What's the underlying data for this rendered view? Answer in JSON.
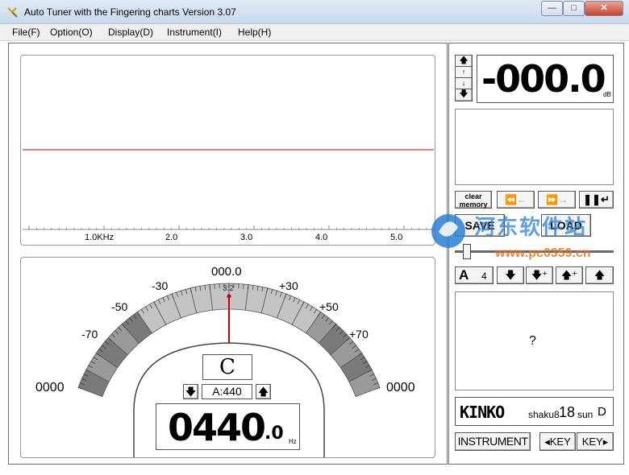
{
  "window": {
    "title": "Auto Tuner with the Fingering charts  Version 3.07",
    "min": "—",
    "max": "□",
    "close": "✕"
  },
  "menu": [
    "File(F)",
    "Option(O)",
    "Display(D)",
    "Instrument(I)",
    "Help(H)"
  ],
  "spectrum": {
    "ticks": [
      "1.0KHz",
      "2.0",
      "3.0",
      "4.0",
      "5.0"
    ]
  },
  "meter": {
    "center_value": "000.0",
    "ratio": "3:2",
    "scale_labels": [
      "-70",
      "-50",
      "-30",
      "+30",
      "+50",
      "+70"
    ],
    "left_value": "0000",
    "right_value": "0000",
    "note": "C",
    "reference": "A:440",
    "frequency_main": "0440",
    "frequency_decimal": ".0",
    "frequency_unit": "Hz"
  },
  "level": {
    "value": "-000.0",
    "unit": "dB"
  },
  "controls": {
    "clear_memory_1": "clear",
    "clear_memory_2": "memory",
    "save": "SAVE",
    "load": "LOAD",
    "transpose_label": "A",
    "transpose_value": "4"
  },
  "fingering": {
    "symbol": "?"
  },
  "instrument": {
    "brand": "KINKO",
    "model": "shaku8",
    "size": "18",
    "unit": "sun",
    "key": "D"
  },
  "bottom_buttons": {
    "instrument": "INSTRUMENT",
    "key_down": "◂KEY",
    "key_up": "KEY▸"
  },
  "watermark": {
    "name": "河东软件站",
    "url": "www.pc0359.cn"
  },
  "colors": {
    "marker": "#cc0000",
    "meter_dark": "#7a7a7a",
    "meter_light": "#c4c4c4",
    "watermark_blue": "#2a7fd4",
    "watermark_orange": "#e8741c"
  }
}
